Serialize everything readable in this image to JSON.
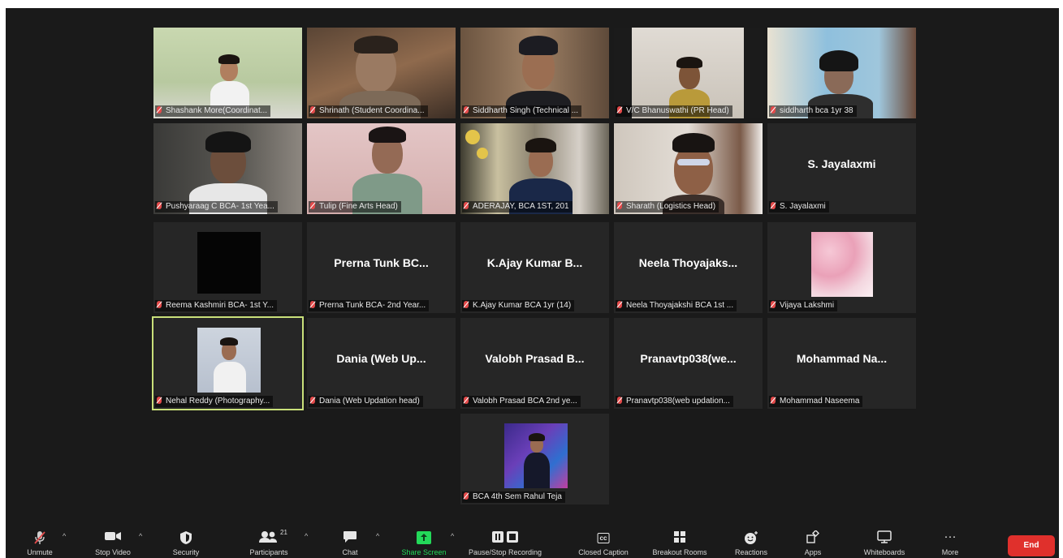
{
  "participants": [
    {
      "caption": "Shashank More(Coordinat...",
      "bg": "#b9c9a4"
    },
    {
      "caption": "Shrinath (Student Coordina...",
      "bg": "#7d6048"
    },
    {
      "caption": "Siddharth Singh (Technical ...",
      "bg": "#8a6b52"
    },
    {
      "caption": "V/C Bhanuswathi (PR Head)",
      "bg": "#cfc7bd"
    },
    {
      "caption": "siddharth bca 1yr 38",
      "bg": "#9cc0d4"
    },
    {
      "caption": "Pushyaraag C BCA- 1st Yea...",
      "bg": "#4c4a47"
    },
    {
      "caption": "Tulip (Fine Arts Head)",
      "bg": "#d6b6b6"
    },
    {
      "caption": "ADERAJAY, BCA 1ST, 201",
      "bg": "#7d7868"
    },
    {
      "caption": "Sharath (Logistics Head)",
      "bg": "#d7cfc6"
    },
    {
      "caption": "S. Jayalaxmi",
      "bigname": "S. Jayalaxmi"
    },
    {
      "caption": "Reema Kashmiri BCA- 1st Y...",
      "bg": "#262626"
    },
    {
      "caption": "Prerna Tunk BCA- 2nd Year...",
      "bigname": "Prerna Tunk BC..."
    },
    {
      "caption": "K.Ajay Kumar BCA 1yr (14)",
      "bigname": "K.Ajay Kumar B..."
    },
    {
      "caption": "Neela Thoyajakshi BCA 1st ...",
      "bigname": "Neela Thoyajaks..."
    },
    {
      "caption": "Vijaya Lakshmi",
      "bg": "#262626"
    },
    {
      "caption": "Nehal Reddy (Photography...",
      "bg": "#262626"
    },
    {
      "caption": "Dania (Web Updation head)",
      "bigname": "Dania (Web Up..."
    },
    {
      "caption": "Valobh Prasad BCA 2nd ye...",
      "bigname": "Valobh Prasad B..."
    },
    {
      "caption": "Pranavtp038(web updation...",
      "bigname": "Pranavtp038(we..."
    },
    {
      "caption": "Mohammad Naseema",
      "bigname": "Mohammad Na..."
    },
    {
      "caption": "BCA 4th Sem Rahul Teja",
      "bg": "#262626"
    }
  ],
  "toolbar": {
    "unmute": "Unmute",
    "stop_video": "Stop Video",
    "security": "Security",
    "participants": "Participants",
    "participants_count": "21",
    "chat": "Chat",
    "share_screen": "Share Screen",
    "pause_recording": "Pause/Stop Recording",
    "closed_caption": "Closed Caption",
    "breakout_rooms": "Breakout Rooms",
    "reactions": "Reactions",
    "apps": "Apps",
    "whiteboards": "Whiteboards",
    "more": "More",
    "end": "End",
    "cc_glyph": "cc",
    "more_glyph": "···",
    "share_color": "#23d959",
    "end_color": "#e0302c"
  }
}
